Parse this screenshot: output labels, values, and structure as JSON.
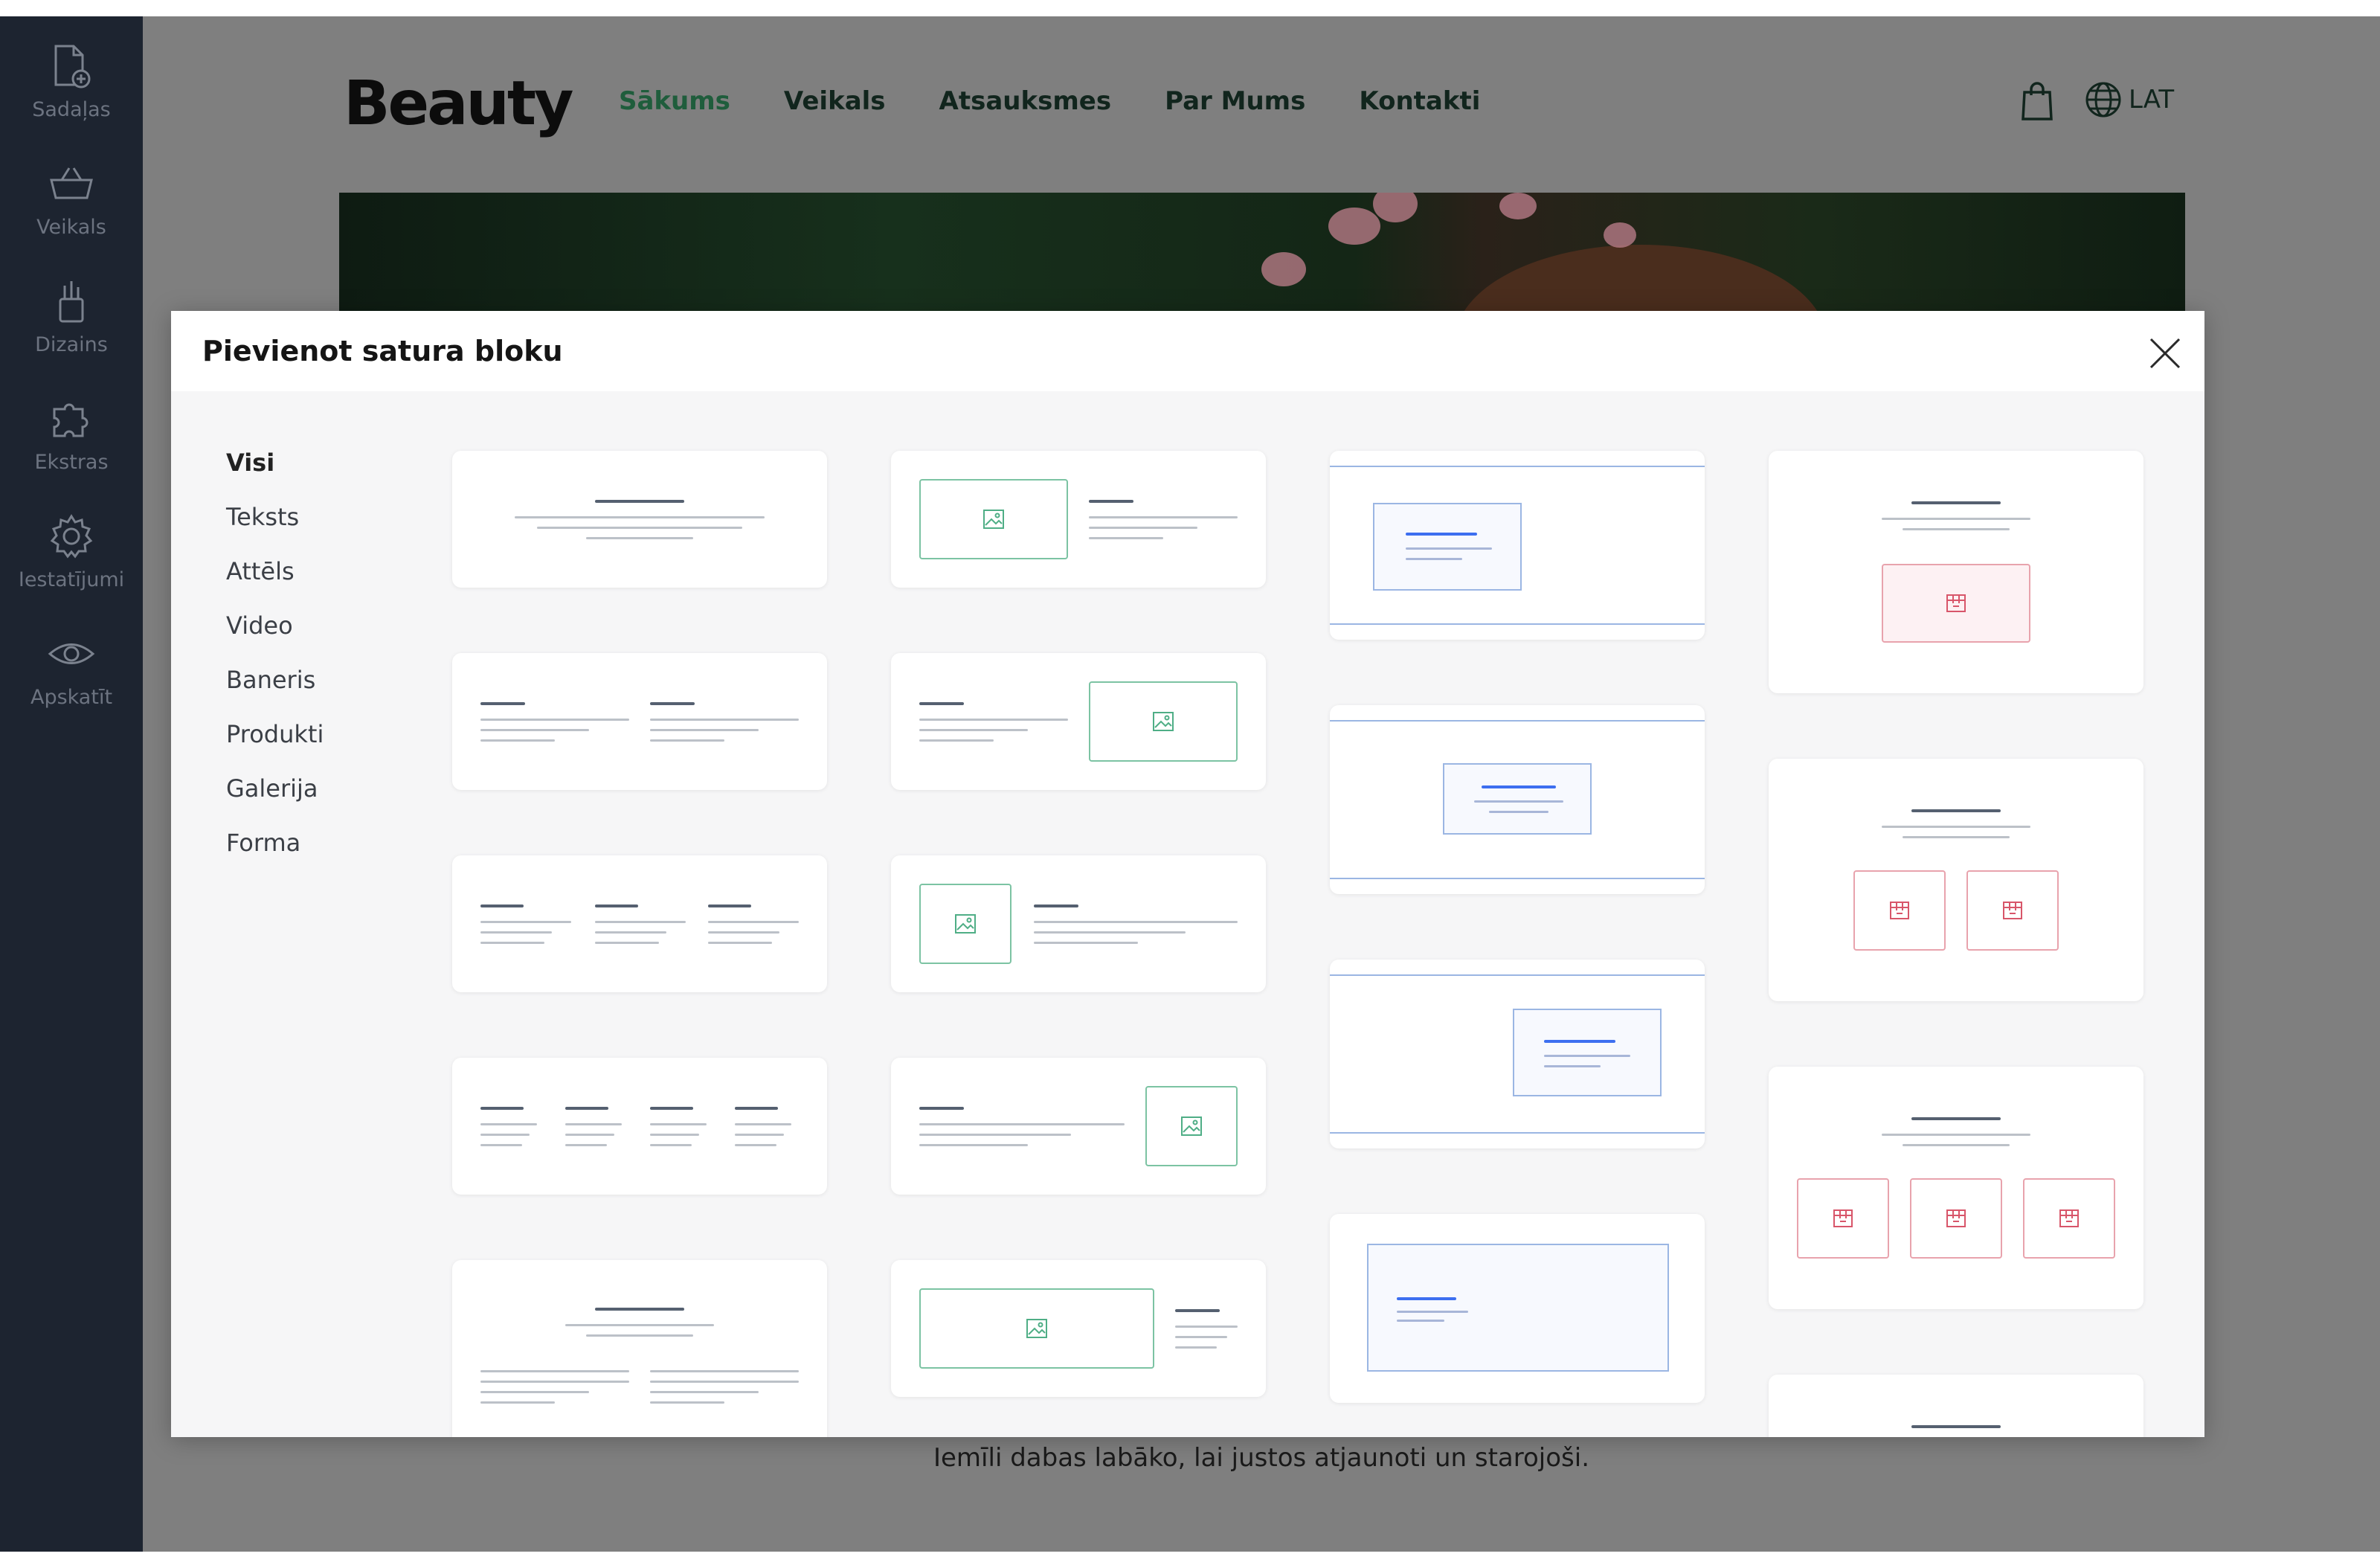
{
  "sidebar": {
    "items": [
      {
        "label": "Sadaļas",
        "icon": "add-page-icon"
      },
      {
        "label": "Veikals",
        "icon": "basket-icon"
      },
      {
        "label": "Dizains",
        "icon": "brush-icon"
      },
      {
        "label": "Ekstras",
        "icon": "puzzle-icon"
      },
      {
        "label": "Iestatījumi",
        "icon": "gear-icon"
      },
      {
        "label": "Apskatīt",
        "icon": "eye-icon"
      }
    ]
  },
  "site": {
    "logo": "Beauty",
    "nav": [
      "Sākums",
      "Veikals",
      "Atsauksmes",
      "Par Mums",
      "Kontakti"
    ],
    "language": "LAT",
    "tail_text": "Iemīli dabas labāko, lai justos atjaunoti un starojoši."
  },
  "modal": {
    "title": "Pievienot satura bloku",
    "categories": [
      "Visi",
      "Teksts",
      "Attēls",
      "Video",
      "Baneris",
      "Produkti",
      "Galerija",
      "Forma"
    ]
  },
  "colors": {
    "sidebar": "#1d2430",
    "accent_green": "#1f5d3c",
    "image_outline": "#7cc3a3",
    "banner_blue": "#3d6ff0",
    "product_pink": "#e8a3ad"
  }
}
